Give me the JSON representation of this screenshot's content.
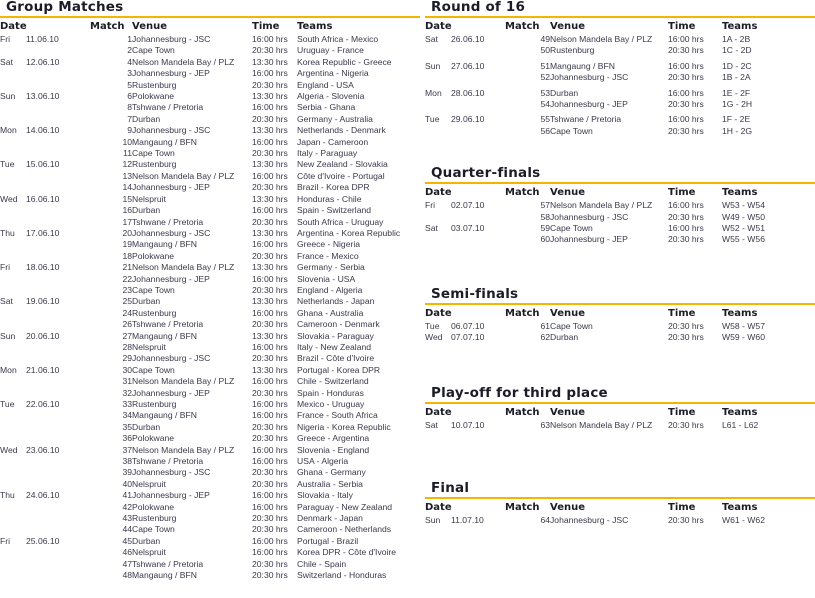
{
  "rule_color": "#f5b400",
  "text_color": "#3a3a4c",
  "columns": {
    "date": "Date",
    "match": "Match",
    "venue": "Venue",
    "time": "Time",
    "teams": "Teams"
  },
  "sections": {
    "group": {
      "title": "Group Matches",
      "rows": [
        {
          "day": "Fri",
          "date": "11.06.10",
          "match": "1",
          "venue": "Johannesburg - JSC",
          "time": "16:00 hrs",
          "teams": "South Africa - Mexico"
        },
        {
          "day": "",
          "date": "",
          "match": "2",
          "venue": "Cape Town",
          "time": "20:30 hrs",
          "teams": "Uruguay - France"
        },
        {
          "day": "Sat",
          "date": "12.06.10",
          "match": "4",
          "venue": "Nelson Mandela Bay / PLZ",
          "time": "13:30 hrs",
          "teams": "Korea Republic - Greece"
        },
        {
          "day": "",
          "date": "",
          "match": "3",
          "venue": "Johannesburg - JEP",
          "time": "16:00 hrs",
          "teams": "Argentina - Nigeria"
        },
        {
          "day": "",
          "date": "",
          "match": "5",
          "venue": "Rustenburg",
          "time": "20:30 hrs",
          "teams": "England - USA"
        },
        {
          "day": "Sun",
          "date": "13.06.10",
          "match": "6",
          "venue": "Polokwane",
          "time": "13:30 hrs",
          "teams": "Algeria - Slovenia"
        },
        {
          "day": "",
          "date": "",
          "match": "8",
          "venue": "Tshwane / Pretoria",
          "time": "16:00 hrs",
          "teams": "Serbia - Ghana"
        },
        {
          "day": "",
          "date": "",
          "match": "7",
          "venue": "Durban",
          "time": "20:30 hrs",
          "teams": "Germany - Australia"
        },
        {
          "day": "Mon",
          "date": "14.06.10",
          "match": "9",
          "venue": "Johannesburg - JSC",
          "time": "13:30 hrs",
          "teams": "Netherlands - Denmark"
        },
        {
          "day": "",
          "date": "",
          "match": "10",
          "venue": "Mangaung / BFN",
          "time": "16:00 hrs",
          "teams": "Japan - Cameroon"
        },
        {
          "day": "",
          "date": "",
          "match": "11",
          "venue": "Cape Town",
          "time": "20:30 hrs",
          "teams": "Italy - Paraguay"
        },
        {
          "day": "Tue",
          "date": "15.06.10",
          "match": "12",
          "venue": "Rustenburg",
          "time": "13:30 hrs",
          "teams": "New Zealand - Slovakia"
        },
        {
          "day": "",
          "date": "",
          "match": "13",
          "venue": "Nelson Mandela Bay / PLZ",
          "time": "16:00 hrs",
          "teams": "Côte d'Ivoire - Portugal"
        },
        {
          "day": "",
          "date": "",
          "match": "14",
          "venue": "Johannesburg - JEP",
          "time": "20:30 hrs",
          "teams": "Brazil - Korea DPR"
        },
        {
          "day": "Wed",
          "date": "16.06.10",
          "match": "15",
          "venue": "Nelspruit",
          "time": "13:30 hrs",
          "teams": "Honduras - Chile"
        },
        {
          "day": "",
          "date": "",
          "match": "16",
          "venue": "Durban",
          "time": "16:00 hrs",
          "teams": "Spain - Switzerland"
        },
        {
          "day": "",
          "date": "",
          "match": "17",
          "venue": "Tshwane / Pretoria",
          "time": "20:30 hrs",
          "teams": "South Africa - Uruguay"
        },
        {
          "day": "Thu",
          "date": "17.06.10",
          "match": "20",
          "venue": "Johannesburg - JSC",
          "time": "13:30 hrs",
          "teams": "Argentina - Korea Republic"
        },
        {
          "day": "",
          "date": "",
          "match": "19",
          "venue": "Mangaung / BFN",
          "time": "16:00 hrs",
          "teams": "Greece - Nigeria"
        },
        {
          "day": "",
          "date": "",
          "match": "18",
          "venue": "Polokwane",
          "time": "20:30 hrs",
          "teams": "France - Mexico"
        },
        {
          "day": "Fri",
          "date": "18.06.10",
          "match": "21",
          "venue": "Nelson Mandela Bay / PLZ",
          "time": "13:30 hrs",
          "teams": "Germany - Serbia"
        },
        {
          "day": "",
          "date": "",
          "match": "22",
          "venue": "Johannesburg - JEP",
          "time": "16:00 hrs",
          "teams": "Slovenia - USA"
        },
        {
          "day": "",
          "date": "",
          "match": "23",
          "venue": "Cape Town",
          "time": "20:30 hrs",
          "teams": "England - Algeria"
        },
        {
          "day": "Sat",
          "date": "19.06.10",
          "match": "25",
          "venue": "Durban",
          "time": "13:30 hrs",
          "teams": "Netherlands - Japan"
        },
        {
          "day": "",
          "date": "",
          "match": "24",
          "venue": "Rustenburg",
          "time": "16:00 hrs",
          "teams": "Ghana - Australia"
        },
        {
          "day": "",
          "date": "",
          "match": "26",
          "venue": "Tshwane / Pretoria",
          "time": "20:30 hrs",
          "teams": "Cameroon - Denmark"
        },
        {
          "day": "Sun",
          "date": "20.06.10",
          "match": "27",
          "venue": "Mangaung / BFN",
          "time": "13:30 hrs",
          "teams": "Slovakia - Paraguay"
        },
        {
          "day": "",
          "date": "",
          "match": "28",
          "venue": "Nelspruit",
          "time": "16:00 hrs",
          "teams": "Italy - New Zealand"
        },
        {
          "day": "",
          "date": "",
          "match": "29",
          "venue": "Johannesburg - JSC",
          "time": "20:30 hrs",
          "teams": "Brazil - Côte d'Ivoire"
        },
        {
          "day": "Mon",
          "date": "21.06.10",
          "match": "30",
          "venue": "Cape Town",
          "time": "13:30 hrs",
          "teams": "Portugal - Korea DPR"
        },
        {
          "day": "",
          "date": "",
          "match": "31",
          "venue": "Nelson Mandela Bay / PLZ",
          "time": "16:00 hrs",
          "teams": "Chile - Switzerland"
        },
        {
          "day": "",
          "date": "",
          "match": "32",
          "venue": "Johannesburg - JEP",
          "time": "20:30 hrs",
          "teams": "Spain - Honduras"
        },
        {
          "day": "Tue",
          "date": "22.06.10",
          "match": "33",
          "venue": "Rustenburg",
          "time": "16:00 hrs",
          "teams": "Mexico - Uruguay"
        },
        {
          "day": "",
          "date": "",
          "match": "34",
          "venue": "Mangaung / BFN",
          "time": "16:00 hrs",
          "teams": "France - South Africa"
        },
        {
          "day": "",
          "date": "",
          "match": "35",
          "venue": "Durban",
          "time": "20:30 hrs",
          "teams": "Nigeria - Korea Republic"
        },
        {
          "day": "",
          "date": "",
          "match": "36",
          "venue": "Polokwane",
          "time": "20:30 hrs",
          "teams": "Greece - Argentina"
        },
        {
          "day": "Wed",
          "date": "23.06.10",
          "match": "37",
          "venue": "Nelson Mandela Bay / PLZ",
          "time": "16:00 hrs",
          "teams": "Slovenia - England"
        },
        {
          "day": "",
          "date": "",
          "match": "38",
          "venue": "Tshwane / Pretoria",
          "time": "16:00 hrs",
          "teams": "USA - Algeria"
        },
        {
          "day": "",
          "date": "",
          "match": "39",
          "venue": "Johannesburg - JSC",
          "time": "20:30 hrs",
          "teams": "Ghana - Germany"
        },
        {
          "day": "",
          "date": "",
          "match": "40",
          "venue": "Nelspruit",
          "time": "20:30 hrs",
          "teams": "Australia - Serbia"
        },
        {
          "day": "Thu",
          "date": "24.06.10",
          "match": "41",
          "venue": "Johannesburg - JEP",
          "time": "16:00 hrs",
          "teams": "Slovakia - Italy"
        },
        {
          "day": "",
          "date": "",
          "match": "42",
          "venue": "Polokwane",
          "time": "16:00 hrs",
          "teams": "Paraguay - New Zealand"
        },
        {
          "day": "",
          "date": "",
          "match": "43",
          "venue": "Rustenburg",
          "time": "20:30 hrs",
          "teams": "Denmark - Japan"
        },
        {
          "day": "",
          "date": "",
          "match": "44",
          "venue": "Cape Town",
          "time": "20:30 hrs",
          "teams": "Cameroon - Netherlands"
        },
        {
          "day": "Fri",
          "date": "25.06.10",
          "match": "45",
          "venue": "Durban",
          "time": "16:00 hrs",
          "teams": "Portugal - Brazil"
        },
        {
          "day": "",
          "date": "",
          "match": "46",
          "venue": "Nelspruit",
          "time": "16:00 hrs",
          "teams": "Korea DPR - Côte d'Ivoire"
        },
        {
          "day": "",
          "date": "",
          "match": "47",
          "venue": "Tshwane / Pretoria",
          "time": "20:30 hrs",
          "teams": "Chile - Spain"
        },
        {
          "day": "",
          "date": "",
          "match": "48",
          "venue": "Mangaung / BFN",
          "time": "20:30 hrs",
          "teams": "Switzerland - Honduras"
        }
      ]
    },
    "round16": {
      "title": "Round of 16",
      "rows": [
        {
          "day": "Sat",
          "date": "26.06.10",
          "match": "49",
          "venue": "Nelson Mandela Bay / PLZ",
          "time": "16:00 hrs",
          "teams": "1A - 2B"
        },
        {
          "day": "",
          "date": "",
          "match": "50",
          "venue": "Rustenburg",
          "time": "20:30 hrs",
          "teams": "1C - 2D"
        },
        {
          "day": "Sun",
          "date": "27.06.10",
          "match": "51",
          "venue": "Mangaung / BFN",
          "time": "16:00 hrs",
          "teams": "1D - 2C"
        },
        {
          "day": "",
          "date": "",
          "match": "52",
          "venue": "Johannesburg - JSC",
          "time": "20:30 hrs",
          "teams": "1B - 2A"
        },
        {
          "day": "Mon",
          "date": "28.06.10",
          "match": "53",
          "venue": "Durban",
          "time": "16:00 hrs",
          "teams": "1E - 2F"
        },
        {
          "day": "",
          "date": "",
          "match": "54",
          "venue": "Johannesburg - JEP",
          "time": "20:30 hrs",
          "teams": "1G - 2H"
        },
        {
          "day": "Tue",
          "date": "29.06.10",
          "match": "55",
          "venue": "Tshwane / Pretoria",
          "time": "16:00 hrs",
          "teams": "1F - 2E"
        },
        {
          "day": "",
          "date": "",
          "match": "56",
          "venue": "Cape Town",
          "time": "20:30 hrs",
          "teams": "1H - 2G"
        }
      ]
    },
    "quarters": {
      "title": "Quarter-finals",
      "rows": [
        {
          "day": "Fri",
          "date": "02.07.10",
          "match": "57",
          "venue": "Nelson Mandela Bay / PLZ",
          "time": "16:00 hrs",
          "teams": "W53  - W54"
        },
        {
          "day": "",
          "date": "",
          "match": "58",
          "venue": "Johannesburg - JSC",
          "time": "20:30 hrs",
          "teams": "W49  - W50"
        },
        {
          "day": "Sat",
          "date": "03.07.10",
          "match": "59",
          "venue": "Cape Town",
          "time": "16:00 hrs",
          "teams": "W52 - W51"
        },
        {
          "day": "",
          "date": "",
          "match": "60",
          "venue": "Johannesburg - JEP",
          "time": "20:30 hrs",
          "teams": "W55 - W56"
        }
      ]
    },
    "semis": {
      "title": "Semi-finals",
      "rows": [
        {
          "day": "Tue",
          "date": "06.07.10",
          "match": "61",
          "venue": "Cape Town",
          "time": "20:30 hrs",
          "teams": "W58 - W57"
        },
        {
          "day": "Wed",
          "date": "07.07.10",
          "match": "62",
          "venue": "Durban",
          "time": "20:30 hrs",
          "teams": "W59 - W60"
        }
      ]
    },
    "thirdplace": {
      "title": "Play-off for third place",
      "rows": [
        {
          "day": "Sat",
          "date": "10.07.10",
          "match": "63",
          "venue": "Nelson Mandela Bay / PLZ",
          "time": "20:30 hrs",
          "teams": "L61 - L62"
        }
      ]
    },
    "final": {
      "title": "Final",
      "rows": [
        {
          "day": "Sun",
          "date": "11.07.10",
          "match": "64",
          "venue": "Johannesburg - JSC",
          "time": "20:30 hrs",
          "teams": "W61 - W62"
        }
      ]
    }
  }
}
